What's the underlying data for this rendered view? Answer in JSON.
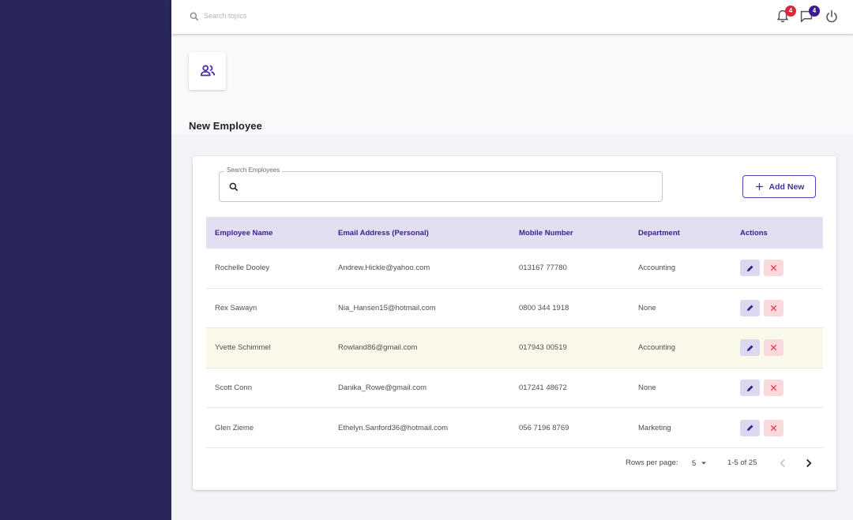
{
  "topbar": {
    "search_placeholder": "Search topics",
    "notifications_count": "4",
    "messages_count": "4",
    "colors": {
      "notification_badge": "#e0233e",
      "message_badge": "#3a1c8f"
    }
  },
  "page": {
    "title": "New Employee",
    "icon": "people-icon"
  },
  "search": {
    "label": "Search Employees",
    "value": "",
    "placeholder": ""
  },
  "add_button": {
    "label": "Add New"
  },
  "table": {
    "headers": [
      "Employee Name",
      "Email Address (Personal)",
      "Mobile Number",
      "Department",
      "Actions"
    ],
    "rows": [
      {
        "name": "Rochelle Dooley",
        "email": "Andrew.Hickle@yahoo.com",
        "mobile": "013167 77780",
        "department": "Accounting"
      },
      {
        "name": "Rex Sawayn",
        "email": "Nia_Hansen15@hotmail.com",
        "mobile": "0800 344 1918",
        "department": "None"
      },
      {
        "name": "Yvette Schimmel",
        "email": "Rowland86@gmail.com",
        "mobile": "017943 00519",
        "department": "Accounting"
      },
      {
        "name": "Scott Conn",
        "email": "Danika_Rowe@gmail.com",
        "mobile": "017241 48672",
        "department": "None"
      },
      {
        "name": "Glen Zieme",
        "email": "Ethelyn.Sanford36@hotmail.com",
        "mobile": "056 7196 8769",
        "department": "Marketing"
      }
    ]
  },
  "pagination": {
    "rows_per_page_label": "Rows per page:",
    "rows_per_page_value": "5",
    "range": "1-5 of 25"
  },
  "colors": {
    "sidebar": "#29265a",
    "accent": "#4a2fa8",
    "table_header_bg": "#e2dff2",
    "highlight_row": "#fbf9ea"
  }
}
